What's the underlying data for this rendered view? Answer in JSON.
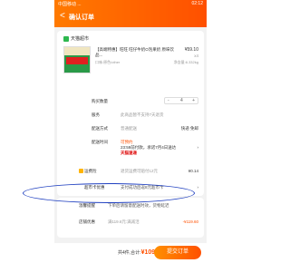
{
  "status": {
    "left": "中国移动 ...",
    "right": "02:12"
  },
  "header": {
    "back": "<",
    "title": "确认订单"
  },
  "store": {
    "name": "天猫超市"
  },
  "product": {
    "name": "【高端特惠】旺旺 旺仔牛奶O泡果奶 原味饮品...",
    "price": "¥59.10",
    "qty": "x4",
    "spec": "口味:原色/other",
    "weight": "净含量:6.332kg"
  },
  "image": {
    "band_text": "旺仔牛奶"
  },
  "rows": {
    "quantity_label": "购买数量",
    "quantity_minus": "-",
    "quantity_value": "4",
    "quantity_plus": "+",
    "service_label": "服务",
    "service_value": "此商品暂不支持7天退货",
    "delivery_label": "配送方式",
    "delivery_value": "普通配送",
    "delivery_right": "快递 免邮",
    "time_label": "配送时间",
    "time_tag": "可预约",
    "time_value": "23:59前付款，承诺7月4日送达",
    "time_brand": "天猫速递",
    "ship_label": "运费险",
    "ship_value": "退货运费可赔付12元",
    "ship_price": "¥0.14",
    "coupon_label": "超市卡优惠",
    "coupon_value": "支付成功后返8元超市卡",
    "reminder_label": "温馨提醒",
    "reminder_value": "下单后请留意配送时效，货物延迟",
    "store_discount_label": "店铺优惠",
    "store_discount_value": "满119.6元:满减活",
    "store_discount_price": "-¥119.60"
  },
  "bottom": {
    "count": "共4件,",
    "total_label": "合计:",
    "total_value": "¥109.80",
    "submit": "提交订单"
  }
}
